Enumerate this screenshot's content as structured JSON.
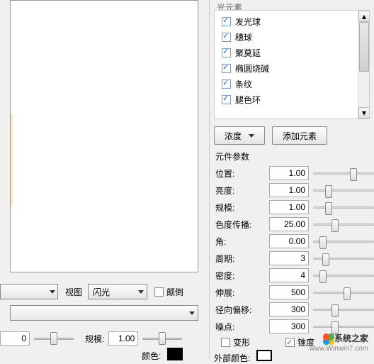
{
  "left": {
    "view_label": "视图",
    "view_value": "闪光",
    "invert_label": "颠倒",
    "scale_label": "规模:",
    "scale_value": "1.00",
    "bottom_value": "0",
    "color_label": "颜色:"
  },
  "right": {
    "group_title": "光元素",
    "items": [
      "发光球",
      "穗球",
      "聚莫延",
      "椭圆烧碱",
      "条纹",
      "腿色环"
    ],
    "density_btn": "浓度",
    "add_btn": "添加元素",
    "params_title": "元件参数",
    "params": [
      {
        "label": "位置:",
        "value": "1.00",
        "pos": 60
      },
      {
        "label": "亮度:",
        "value": "1.00",
        "pos": 20
      },
      {
        "label": "规模:",
        "value": "1.00",
        "pos": 20
      },
      {
        "label": "色度传播:",
        "value": "25.00",
        "pos": 30
      },
      {
        "label": "角:",
        "value": "0.00",
        "pos": 10
      },
      {
        "label": "周期:",
        "value": "3",
        "pos": 15
      },
      {
        "label": "密度:",
        "value": "4",
        "pos": 10
      },
      {
        "label": "伸展:",
        "value": "500",
        "pos": 50
      },
      {
        "label": "径向偏移:",
        "value": "300",
        "pos": 30
      },
      {
        "label": "噪点:",
        "value": "300",
        "pos": 30
      }
    ],
    "deform_label": "变形",
    "taper_label": "锥度",
    "ext_color_label": "外部颜色:"
  },
  "watermark": {
    "line1": "系统之家",
    "line2": "www.Winwin7.com"
  }
}
